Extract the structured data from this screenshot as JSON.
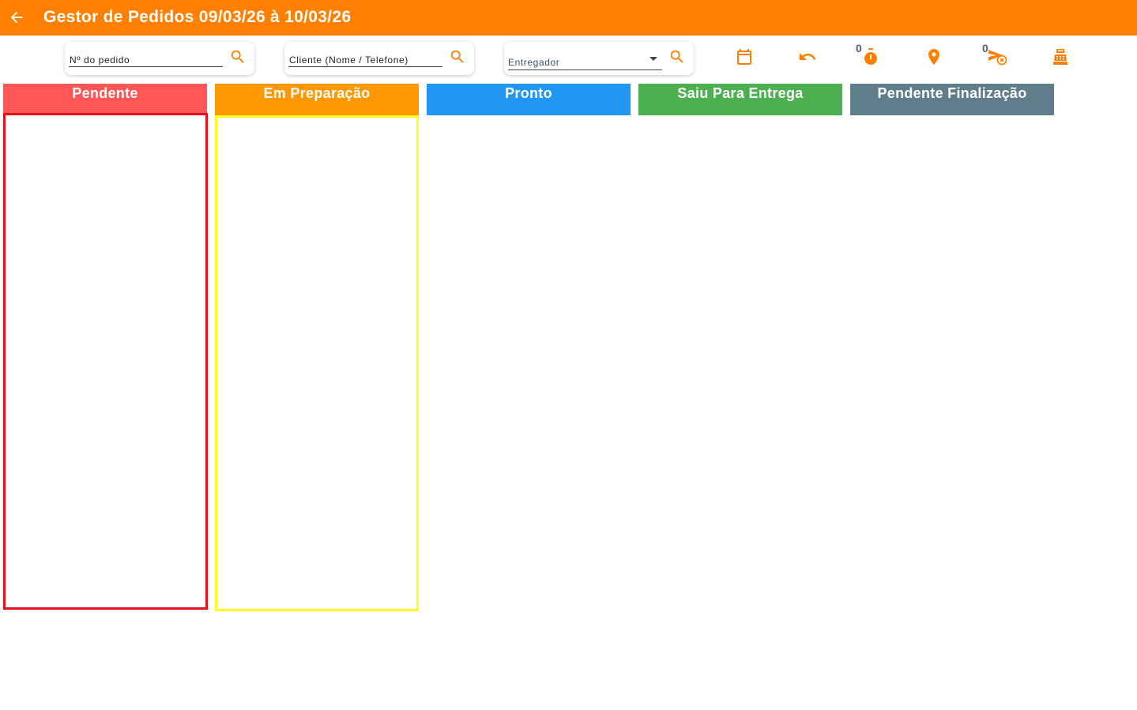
{
  "appbar": {
    "title": "Gestor de Pedidos 09/03/26 à 10/03/26",
    "color": "#ff8000"
  },
  "filters": {
    "order_number_placeholder": "Nº do pedido",
    "client_placeholder": "Cliente (Nome / Telefone)",
    "courier_label": "Entregador"
  },
  "toolbar": {
    "timer_count": "0",
    "cancel_delivery_count": "0",
    "icon_color": "#ff8000"
  },
  "columns": [
    {
      "label": "Pendente",
      "color": "#ff5757",
      "border": "#e8111a"
    },
    {
      "label": "Em Preparação",
      "color": "#ff9800",
      "border": "#ffff1a"
    },
    {
      "label": "Pronto",
      "color": "#2196f3"
    },
    {
      "label": "Saiu Para Entrega",
      "color": "#4caf50"
    },
    {
      "label": "Pendente Finalização",
      "color": "#607d8b"
    }
  ]
}
